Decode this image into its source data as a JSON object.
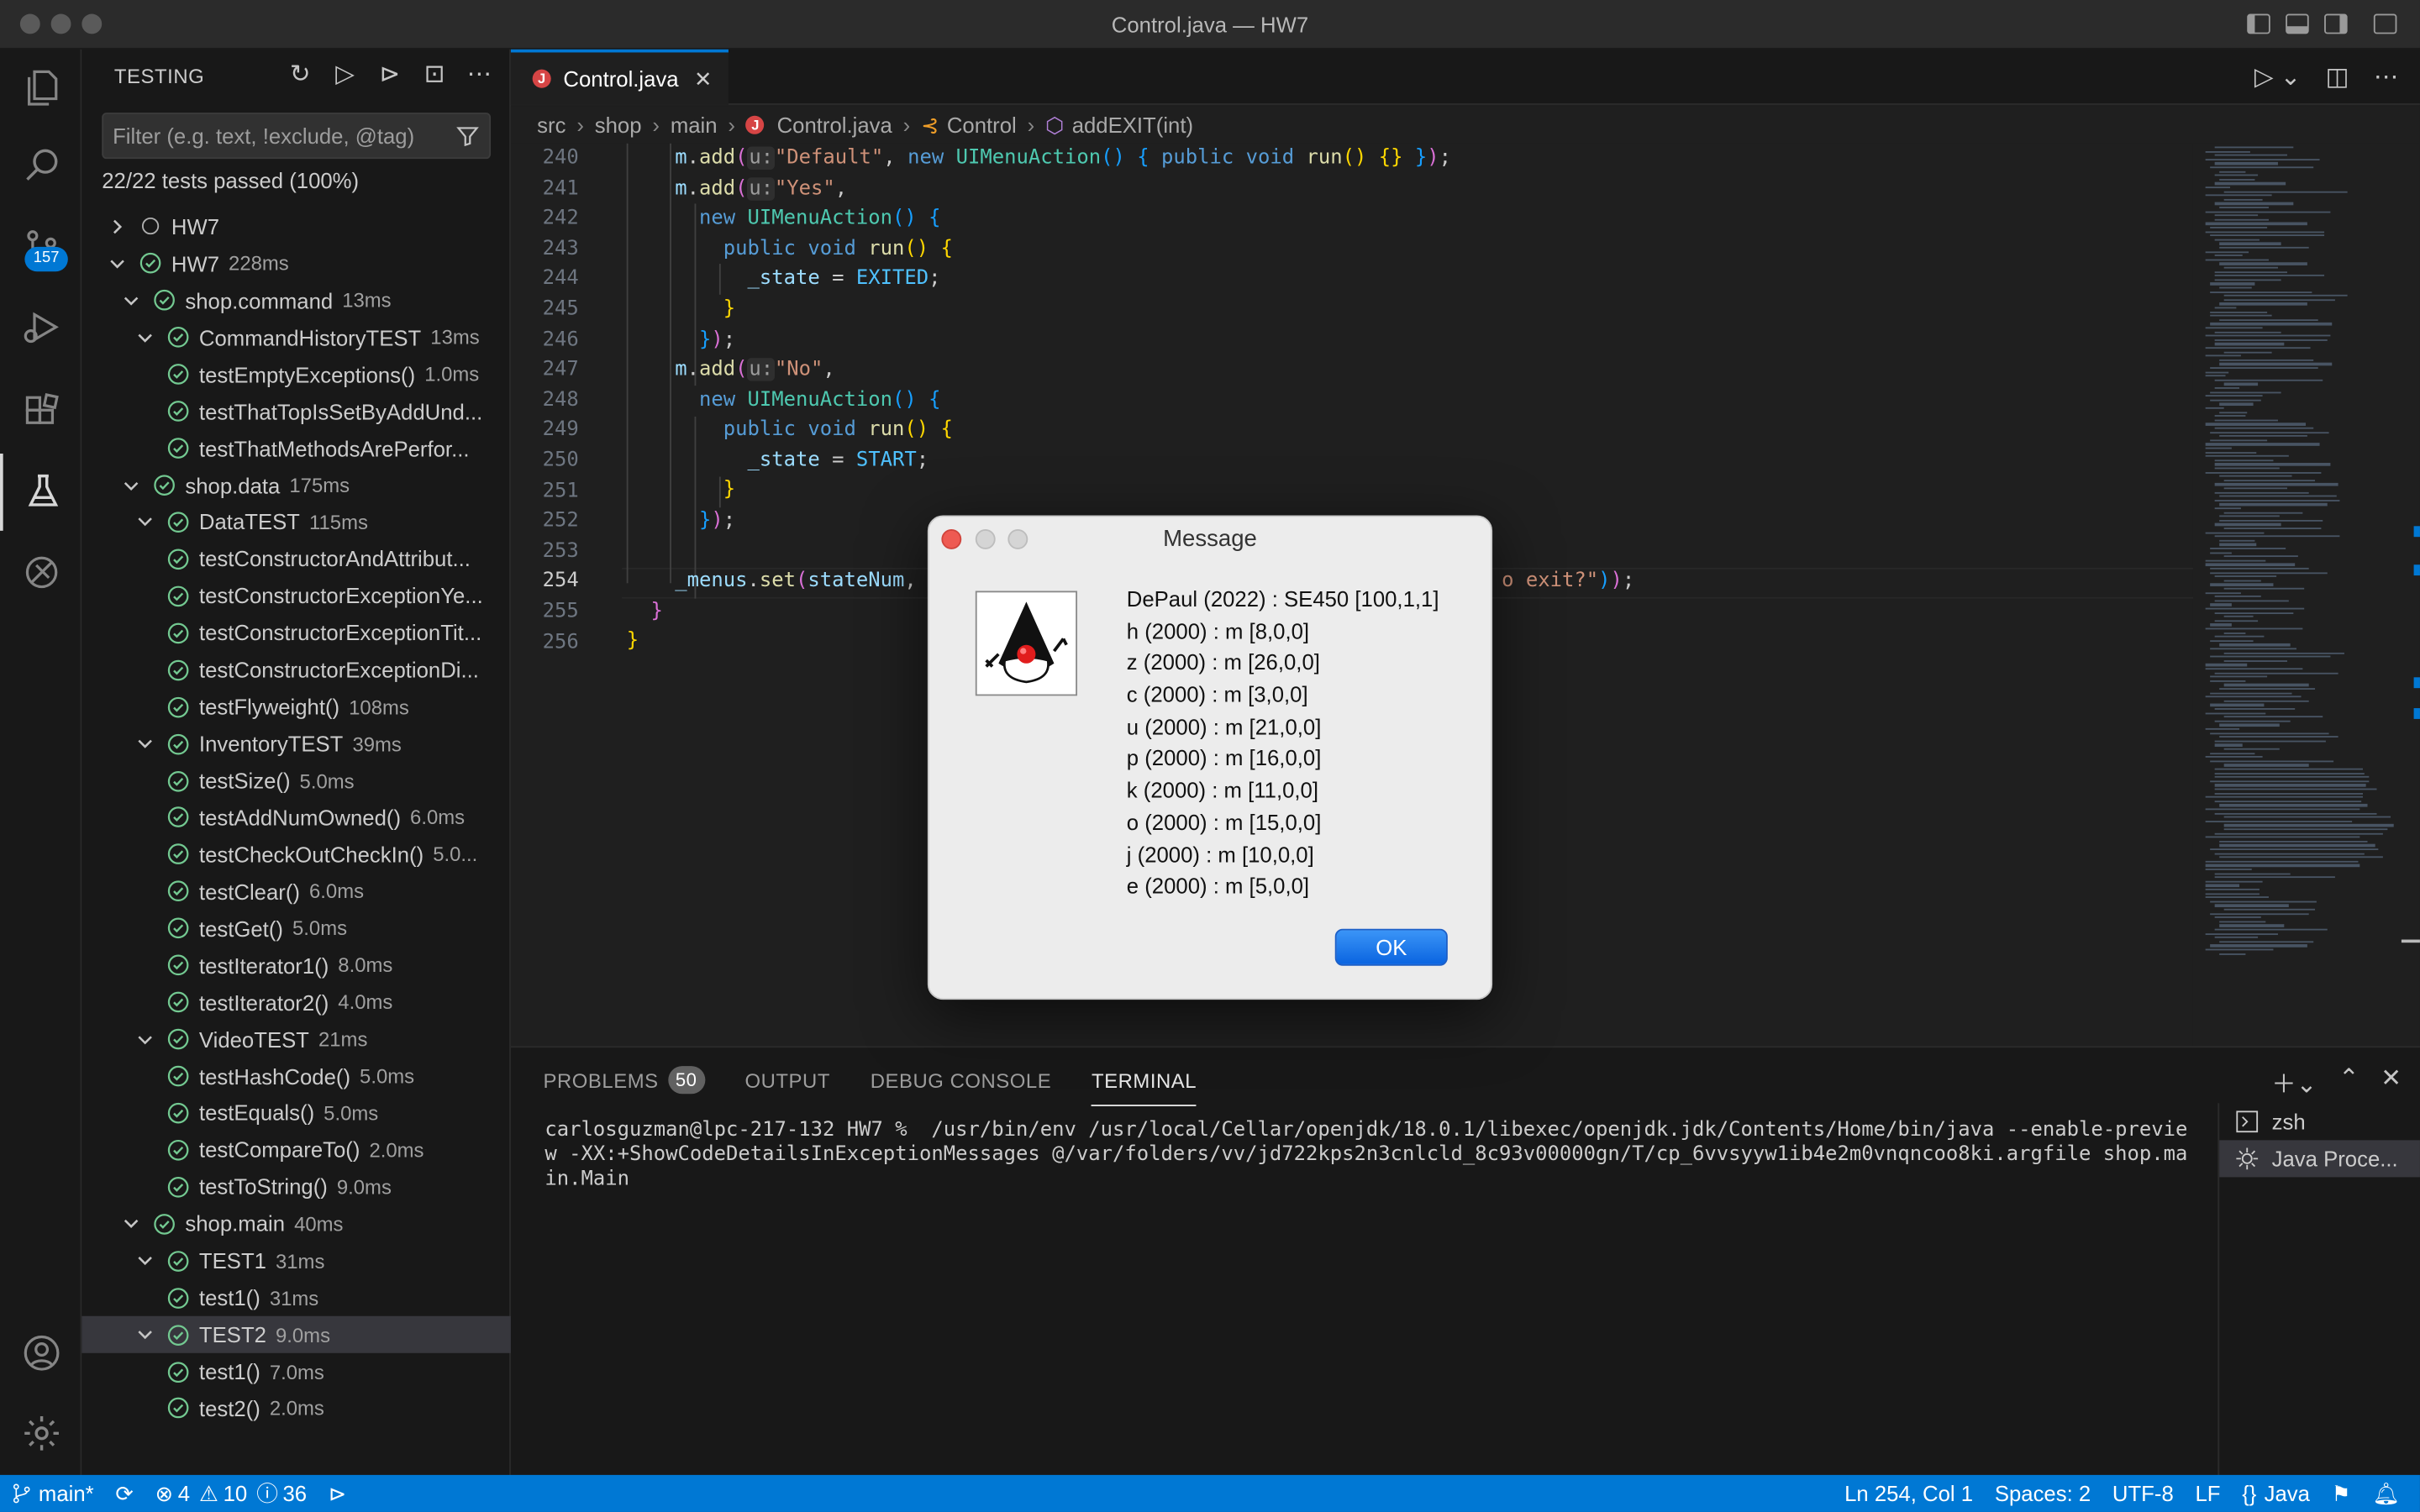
{
  "window": {
    "title": "Control.java — HW7"
  },
  "activity_bar": {
    "scm_badge": "157"
  },
  "sidebar": {
    "title": "TESTING",
    "filter_placeholder": "Filter (e.g. text, !exclude, @tag)",
    "summary": "22/22 tests passed (100%)",
    "tree": [
      {
        "level": 0,
        "chevron": "right",
        "status": "none",
        "name": "HW7",
        "duration": ""
      },
      {
        "level": 0,
        "chevron": "down",
        "status": "passed",
        "name": "HW7",
        "duration": "228ms"
      },
      {
        "level": 1,
        "chevron": "down",
        "status": "passed",
        "name": "shop.command",
        "duration": "13ms"
      },
      {
        "level": 2,
        "chevron": "down",
        "status": "passed",
        "name": "CommandHistoryTEST",
        "duration": "13ms"
      },
      {
        "level": 3,
        "chevron": "",
        "status": "passed",
        "name": "testEmptyExceptions()",
        "duration": "1.0ms"
      },
      {
        "level": 3,
        "chevron": "",
        "status": "passed",
        "name": "testThatTopIsSetByAddUnd...",
        "duration": ""
      },
      {
        "level": 3,
        "chevron": "",
        "status": "passed",
        "name": "testThatMethodsArePerfor...",
        "duration": ""
      },
      {
        "level": 1,
        "chevron": "down",
        "status": "passed",
        "name": "shop.data",
        "duration": "175ms"
      },
      {
        "level": 2,
        "chevron": "down",
        "status": "passed",
        "name": "DataTEST",
        "duration": "115ms"
      },
      {
        "level": 3,
        "chevron": "",
        "status": "passed",
        "name": "testConstructorAndAttribut...",
        "duration": ""
      },
      {
        "level": 3,
        "chevron": "",
        "status": "passed",
        "name": "testConstructorExceptionYe...",
        "duration": ""
      },
      {
        "level": 3,
        "chevron": "",
        "status": "passed",
        "name": "testConstructorExceptionTit...",
        "duration": ""
      },
      {
        "level": 3,
        "chevron": "",
        "status": "passed",
        "name": "testConstructorExceptionDi...",
        "duration": ""
      },
      {
        "level": 3,
        "chevron": "",
        "status": "passed",
        "name": "testFlyweight()",
        "duration": "108ms"
      },
      {
        "level": 2,
        "chevron": "down",
        "status": "passed",
        "name": "InventoryTEST",
        "duration": "39ms"
      },
      {
        "level": 3,
        "chevron": "",
        "status": "passed",
        "name": "testSize()",
        "duration": "5.0ms"
      },
      {
        "level": 3,
        "chevron": "",
        "status": "passed",
        "name": "testAddNumOwned()",
        "duration": "6.0ms"
      },
      {
        "level": 3,
        "chevron": "",
        "status": "passed",
        "name": "testCheckOutCheckIn()",
        "duration": "5.0..."
      },
      {
        "level": 3,
        "chevron": "",
        "status": "passed",
        "name": "testClear()",
        "duration": "6.0ms"
      },
      {
        "level": 3,
        "chevron": "",
        "status": "passed",
        "name": "testGet()",
        "duration": "5.0ms"
      },
      {
        "level": 3,
        "chevron": "",
        "status": "passed",
        "name": "testIterator1()",
        "duration": "8.0ms"
      },
      {
        "level": 3,
        "chevron": "",
        "status": "passed",
        "name": "testIterator2()",
        "duration": "4.0ms"
      },
      {
        "level": 2,
        "chevron": "down",
        "status": "passed",
        "name": "VideoTEST",
        "duration": "21ms"
      },
      {
        "level": 3,
        "chevron": "",
        "status": "passed",
        "name": "testHashCode()",
        "duration": "5.0ms"
      },
      {
        "level": 3,
        "chevron": "",
        "status": "passed",
        "name": "testEquals()",
        "duration": "5.0ms"
      },
      {
        "level": 3,
        "chevron": "",
        "status": "passed",
        "name": "testCompareTo()",
        "duration": "2.0ms"
      },
      {
        "level": 3,
        "chevron": "",
        "status": "passed",
        "name": "testToString()",
        "duration": "9.0ms"
      },
      {
        "level": 1,
        "chevron": "down",
        "status": "passed",
        "name": "shop.main",
        "duration": "40ms"
      },
      {
        "level": 2,
        "chevron": "down",
        "status": "passed",
        "name": "TEST1",
        "duration": "31ms"
      },
      {
        "level": 3,
        "chevron": "",
        "status": "passed",
        "name": "test1()",
        "duration": "31ms"
      },
      {
        "level": 2,
        "chevron": "down",
        "status": "passed",
        "name": "TEST2",
        "duration": "9.0ms",
        "selected": true
      },
      {
        "level": 3,
        "chevron": "",
        "status": "passed",
        "name": "test1()",
        "duration": "7.0ms"
      },
      {
        "level": 3,
        "chevron": "",
        "status": "passed",
        "name": "test2()",
        "duration": "2.0ms"
      }
    ]
  },
  "editor": {
    "tab_label": "Control.java",
    "breadcrumb": {
      "src": "src",
      "shop": "shop",
      "main": "main",
      "file": "Control.java",
      "class": "Control",
      "method": "addEXIT(int)"
    },
    "line_numbers": [
      "240",
      "241",
      "242",
      "243",
      "244",
      "245",
      "246",
      "247",
      "248",
      "249",
      "250",
      "251",
      "252",
      "253",
      "254",
      "255",
      "256"
    ],
    "current_line": "254",
    "code": {
      "s_default": "\"Default\"",
      "s_yes": "\"Yes\"",
      "s_no": "\"No\"",
      "s_exit_tail": "o exit?\"",
      "hint": "u:",
      "exited": "EXITED",
      "start": "START"
    }
  },
  "panel": {
    "tabs": {
      "problems": "PROBLEMS",
      "problems_count": "50",
      "output": "OUTPUT",
      "debug": "DEBUG CONSOLE",
      "terminal": "TERMINAL"
    },
    "terminal_text": "carlosguzman@lpc-217-132 HW7 %  /usr/bin/env /usr/local/Cellar/openjdk/18.0.1/libexec/openjdk.jdk/Contents/Home/bin/java --enable-preview -XX:+ShowCodeDetailsInExceptionMessages @/var/folders/vv/jd722kps2n3cnlcld_8c93v00000gn/T/cp_6vvsyyw1ib4e2m0vnqncoo8ki.argfile shop.main.Main",
    "terminals": [
      "zsh",
      "Java Proce..."
    ]
  },
  "dialog": {
    "title": "Message",
    "lines": [
      "DePaul (2022) : SE450 [100,1,1]",
      "h (2000) : m [8,0,0]",
      "z (2000) : m [26,0,0]",
      "c (2000) : m [3,0,0]",
      "u (2000) : m [21,0,0]",
      "p (2000) : m [16,0,0]",
      "k (2000) : m [11,0,0]",
      "o (2000) : m [15,0,0]",
      "j (2000) : m [10,0,0]",
      "e (2000) : m [5,0,0]"
    ],
    "ok_label": "OK"
  },
  "status_bar": {
    "branch": "main*",
    "errors": "4",
    "warnings": "10",
    "infos": "36",
    "position": "Ln 254, Col 1",
    "spaces": "Spaces: 2",
    "encoding": "UTF-8",
    "eol": "LF",
    "language": "Java"
  },
  "colors": {
    "accent": "#0078d4",
    "pass": "#73c991",
    "background": "#1f1f1f",
    "sidebar": "#181818"
  }
}
